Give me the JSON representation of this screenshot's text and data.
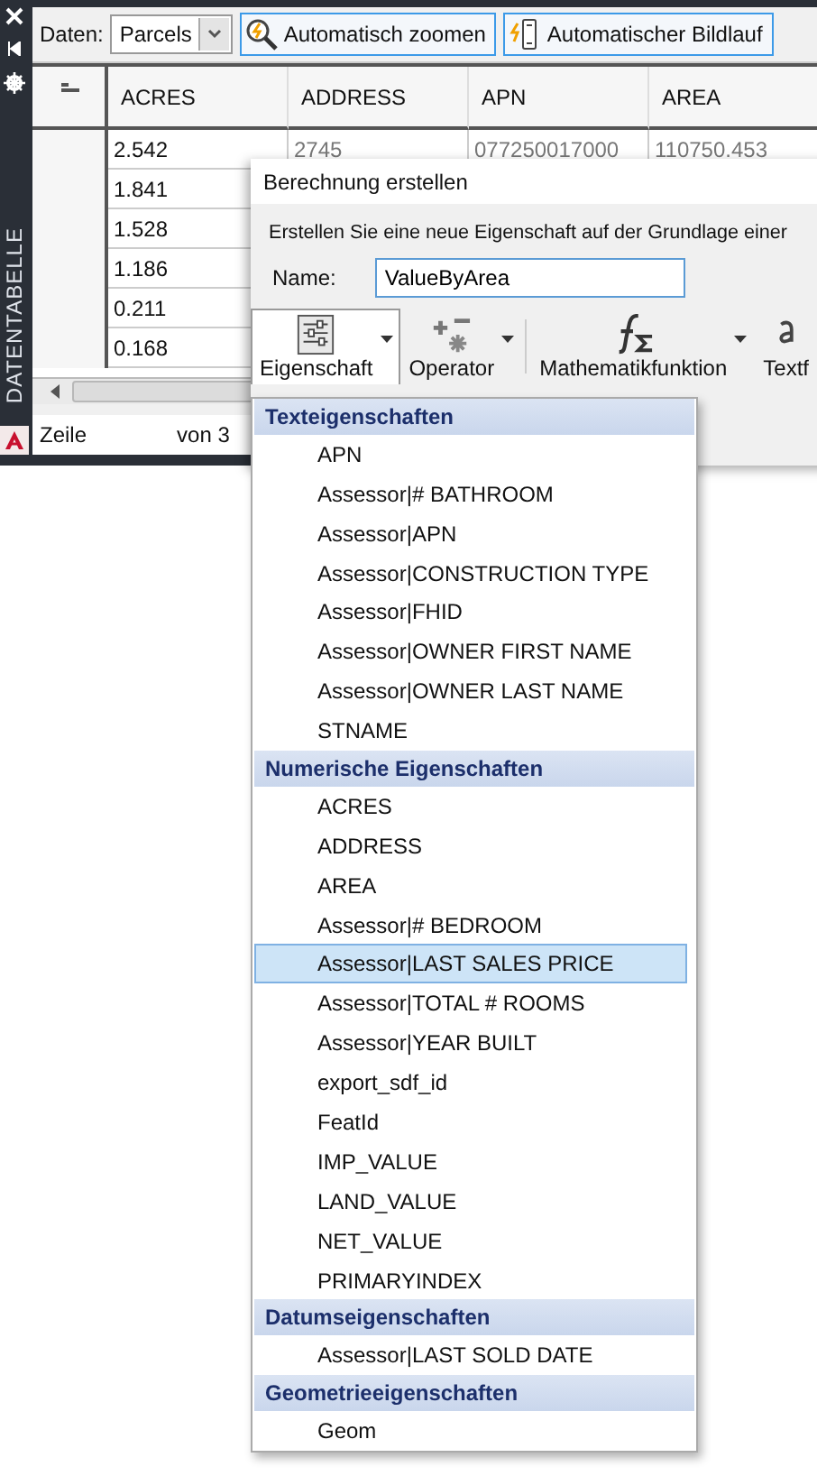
{
  "palette": {
    "title": "DATENTABELLE",
    "data_label": "Daten:",
    "data_source": "Parcels",
    "buttons": [
      {
        "kind": "zoom",
        "label": "Automatisch zoomen"
      },
      {
        "kind": "scroll",
        "label": "Automatischer Bildlauf"
      }
    ],
    "table": {
      "columns": [
        "ACRES",
        "ADDRESS",
        "APN",
        "AREA"
      ],
      "rows": [
        [
          "2.542",
          "2745",
          "077250017000",
          "110750.453"
        ],
        [
          "1.841"
        ],
        [
          "1.528"
        ],
        [
          "1.186"
        ],
        [
          "0.211"
        ],
        [
          "0.168"
        ]
      ]
    },
    "status": {
      "row_label": "Zeile",
      "of_label": "von 3"
    }
  },
  "dialog": {
    "title": "Berechnung erstellen",
    "description": "Erstellen Sie eine neue Eigenschaft auf der Grundlage einer",
    "name_label": "Name:",
    "name_value": "ValueByArea",
    "tools": [
      {
        "kind": "property",
        "label": "Eigenschaft",
        "selected": true,
        "has_menu": true
      },
      {
        "kind": "operator",
        "label": "Operator",
        "selected": false,
        "has_menu": true
      },
      {
        "kind": "math",
        "label": "Mathematikfunktion",
        "selected": false,
        "has_menu": true
      },
      {
        "kind": "text",
        "label": "Textf",
        "selected": false,
        "has_menu": false
      }
    ]
  },
  "menu": {
    "groups": [
      {
        "title": "Texteigenschaften",
        "items": [
          {
            "label": "APN",
            "selected": false
          },
          {
            "label": "Assessor|# BATHROOM",
            "selected": false
          },
          {
            "label": "Assessor|APN",
            "selected": false
          },
          {
            "label": "Assessor|CONSTRUCTION TYPE",
            "selected": false
          },
          {
            "label": "Assessor|FHID",
            "selected": false
          },
          {
            "label": "Assessor|OWNER FIRST NAME",
            "selected": false
          },
          {
            "label": "Assessor|OWNER LAST NAME",
            "selected": false
          },
          {
            "label": "STNAME",
            "selected": false
          }
        ]
      },
      {
        "title": "Numerische Eigenschaften",
        "items": [
          {
            "label": "ACRES",
            "selected": false
          },
          {
            "label": "ADDRESS",
            "selected": false
          },
          {
            "label": "AREA",
            "selected": false
          },
          {
            "label": "Assessor|# BEDROOM",
            "selected": false
          },
          {
            "label": "Assessor|LAST SALES PRICE",
            "selected": true
          },
          {
            "label": "Assessor|TOTAL # ROOMS",
            "selected": false
          },
          {
            "label": "Assessor|YEAR BUILT",
            "selected": false
          },
          {
            "label": "export_sdf_id",
            "selected": false
          },
          {
            "label": "FeatId",
            "selected": false
          },
          {
            "label": "IMP_VALUE",
            "selected": false
          },
          {
            "label": "LAND_VALUE",
            "selected": false
          },
          {
            "label": "NET_VALUE",
            "selected": false
          },
          {
            "label": "PRIMARYINDEX",
            "selected": false
          }
        ]
      },
      {
        "title": "Datumseigenschaften",
        "items": [
          {
            "label": "Assessor|LAST SOLD DATE",
            "selected": false
          }
        ]
      },
      {
        "title": "Geometrieeigenschaften",
        "items": [
          {
            "label": "Geom",
            "selected": false
          }
        ]
      }
    ]
  }
}
